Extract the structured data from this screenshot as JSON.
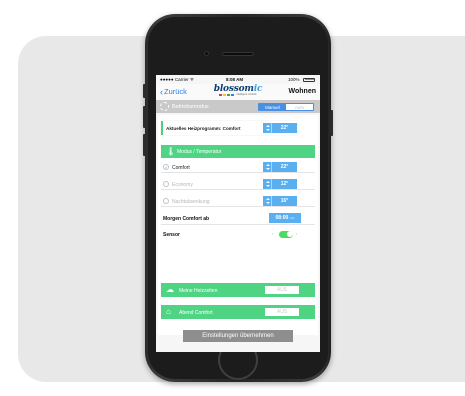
{
  "status_bar": {
    "carrier": "●●●●● Carrier ᯤ",
    "time": "8:08 AM",
    "battery": "100%"
  },
  "nav": {
    "back_label": "Zurück",
    "logo_text": "blossom",
    "logo_suffix": "ic",
    "logo_tagline": "intelligent controls",
    "title": "Wohnen"
  },
  "mode_bar": {
    "label": "Betriebsmodus",
    "options": [
      "Manuel",
      "Auto"
    ],
    "selected": "Manuel"
  },
  "program_row": {
    "label": "Aktuelles Heizprogramm: Comfort",
    "value": "22°"
  },
  "mode_section": {
    "header": "Modus / Temperatur",
    "options": [
      {
        "label": "Comfort",
        "value": "22°",
        "checked_mark": "✓"
      },
      {
        "label": "Economy",
        "value": "12°",
        "checked_mark": ""
      },
      {
        "label": "Nachtabsenkung",
        "value": "16°",
        "checked_mark": ""
      }
    ]
  },
  "morning": {
    "label": "Morgen Comfort ab",
    "time": "08:00",
    "unit": "Uhr"
  },
  "sensor": {
    "label": "Sensor",
    "on": true
  },
  "heating_times": {
    "label": "Meine Heizzeiten",
    "state": "AUS"
  },
  "evening": {
    "label": "Abend Comfort",
    "state": "AUS"
  },
  "apply_button": "Einstellungen übernehmen",
  "colors": {
    "accent_blue": "#4a90e2",
    "green": "#4fd484",
    "stepper_blue": "#5aaff0"
  }
}
